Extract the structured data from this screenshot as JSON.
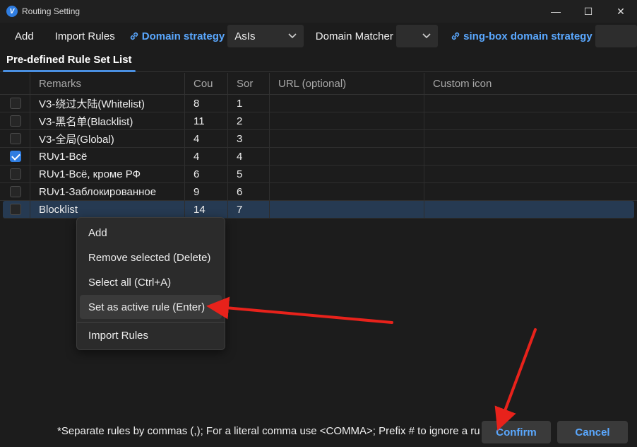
{
  "window": {
    "title": "Routing Setting",
    "app_icon_letter": "V",
    "minimize": "—",
    "maximize": "☐",
    "close": "✕"
  },
  "toolbar": {
    "add_label": "Add",
    "import_label": "Import Rules",
    "domain_strategy_label": "Domain strategy",
    "domain_strategy_value": "AsIs",
    "domain_matcher_label": "Domain Matcher",
    "domain_matcher_value": "",
    "singbox_label": "sing-box domain strategy"
  },
  "tabs": [
    {
      "label": "Pre-defined Rule Set List",
      "active": true
    }
  ],
  "table": {
    "columns": [
      "Remarks",
      "Cou",
      "Sor",
      "URL (optional)",
      "Custom icon"
    ],
    "rows": [
      {
        "checked": false,
        "remarks": "V3-绕过大陆(Whitelist)",
        "count": "8",
        "sort": "1"
      },
      {
        "checked": false,
        "remarks": "V3-黑名单(Blacklist)",
        "count": "11",
        "sort": "2"
      },
      {
        "checked": false,
        "remarks": "V3-全局(Global)",
        "count": "4",
        "sort": "3"
      },
      {
        "checked": true,
        "remarks": "RUv1-Всё",
        "count": "4",
        "sort": "4"
      },
      {
        "checked": false,
        "remarks": "RUv1-Всё, кроме РФ",
        "count": "6",
        "sort": "5"
      },
      {
        "checked": false,
        "remarks": "RUv1-Заблокированное",
        "count": "9",
        "sort": "6"
      },
      {
        "checked": false,
        "remarks": "Blocklist",
        "count": "14",
        "sort": "7",
        "selected": true
      }
    ]
  },
  "context_menu": {
    "items": [
      {
        "label": "Add"
      },
      {
        "label": "Remove selected (Delete)"
      },
      {
        "label": "Select all (Ctrl+A)"
      },
      {
        "label": "Set as active rule (Enter)",
        "hover": true
      },
      {
        "label": "Import Rules"
      }
    ]
  },
  "footer": {
    "note": "*Separate rules by commas (,); For a literal comma use <COMMA>; Prefix # to ignore a ru",
    "confirm_label": "Confirm",
    "cancel_label": "Cancel"
  },
  "colors": {
    "accent": "#5aa8ff",
    "arrow": "#e8221b",
    "selection": "#263a52"
  }
}
